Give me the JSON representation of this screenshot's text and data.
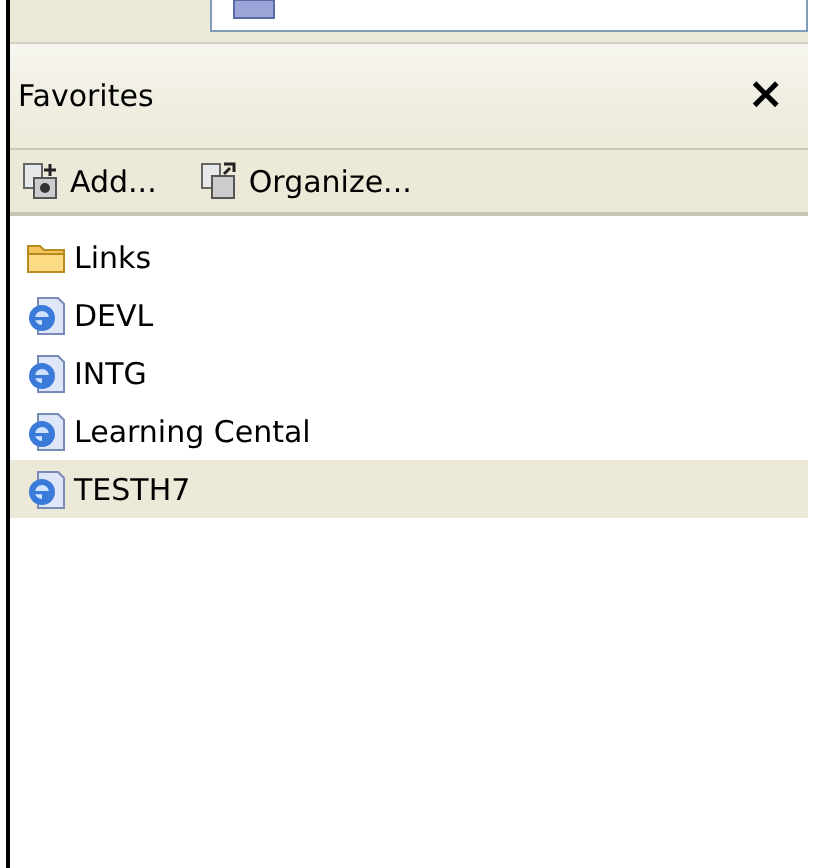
{
  "panel": {
    "title": "Favorites",
    "close": "×"
  },
  "toolbar": [
    {
      "kind": "add",
      "label": "Add..."
    },
    {
      "kind": "organize",
      "label": "Organize..."
    }
  ],
  "items": [
    {
      "kind": "folder",
      "label": "Links",
      "selected": false
    },
    {
      "kind": "page",
      "label": "DEVL",
      "selected": false
    },
    {
      "kind": "page",
      "label": "INTG",
      "selected": false
    },
    {
      "kind": "page",
      "label": "Learning Cental",
      "selected": false
    },
    {
      "kind": "page",
      "label": "TESTH7",
      "selected": true
    }
  ]
}
